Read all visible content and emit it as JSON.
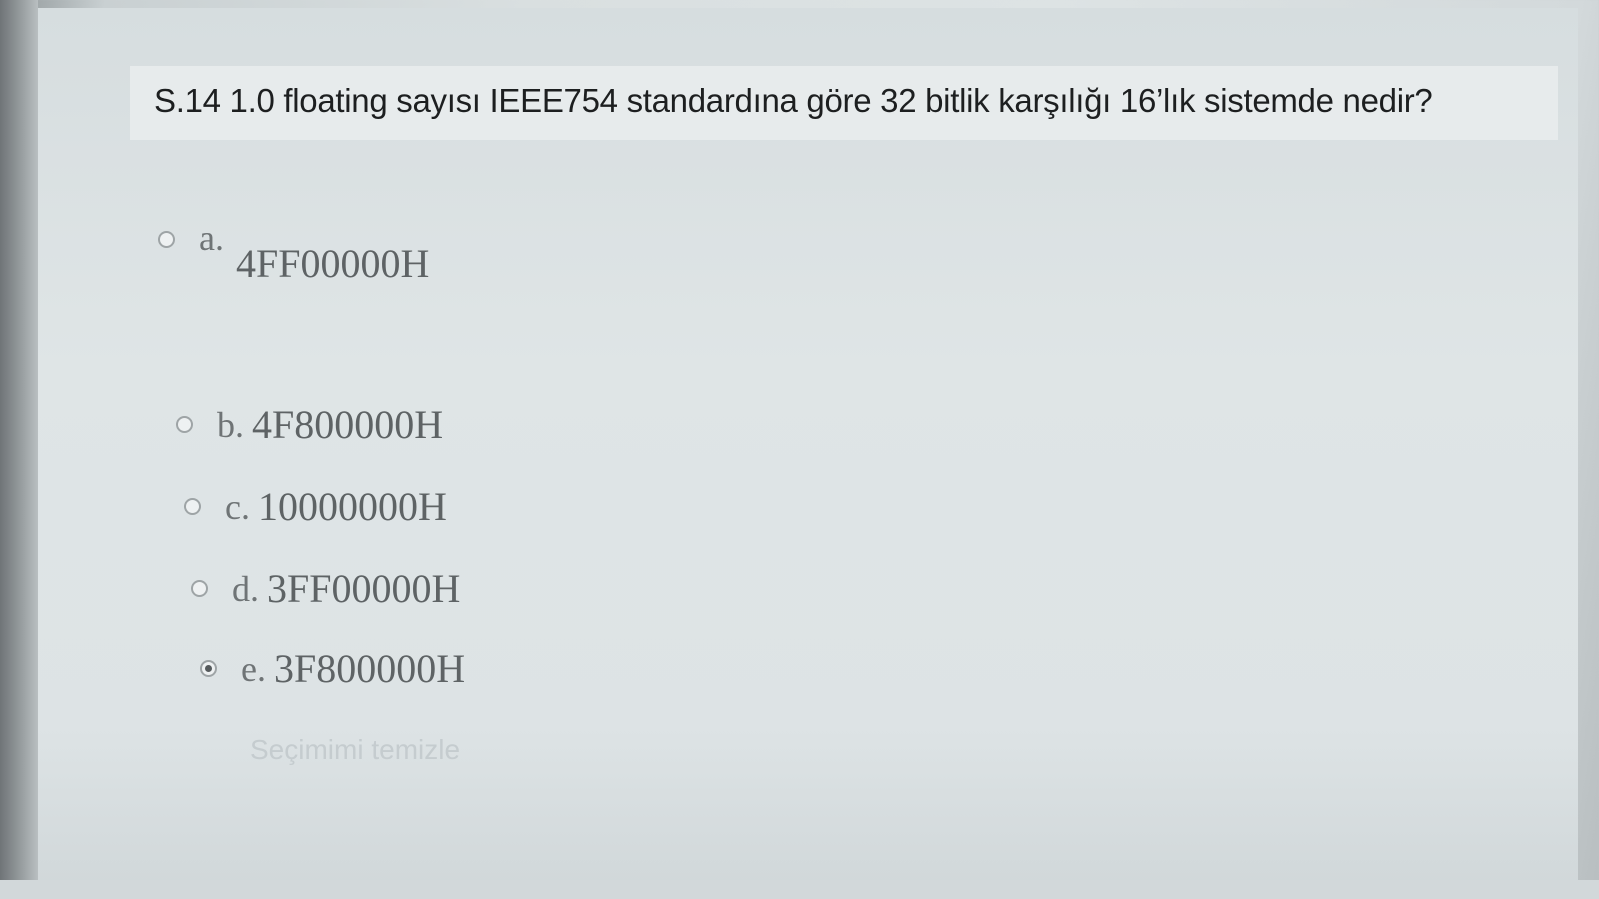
{
  "question": {
    "text": "S.14 1.0 floating sayısı IEEE754 standardına göre 32 bitlik karşılığı 16’lık sistemde nedir?"
  },
  "options": [
    {
      "letter": "a.",
      "value": "4FF00000H",
      "selected": false
    },
    {
      "letter": "b.",
      "value": "4F800000H",
      "selected": false
    },
    {
      "letter": "c.",
      "value": "10000000H",
      "selected": false
    },
    {
      "letter": "d.",
      "value": "3FF00000H",
      "selected": false
    },
    {
      "letter": "e.",
      "value": "3F800000H",
      "selected": true
    }
  ],
  "clear_choice": "Seçimimi temizle"
}
